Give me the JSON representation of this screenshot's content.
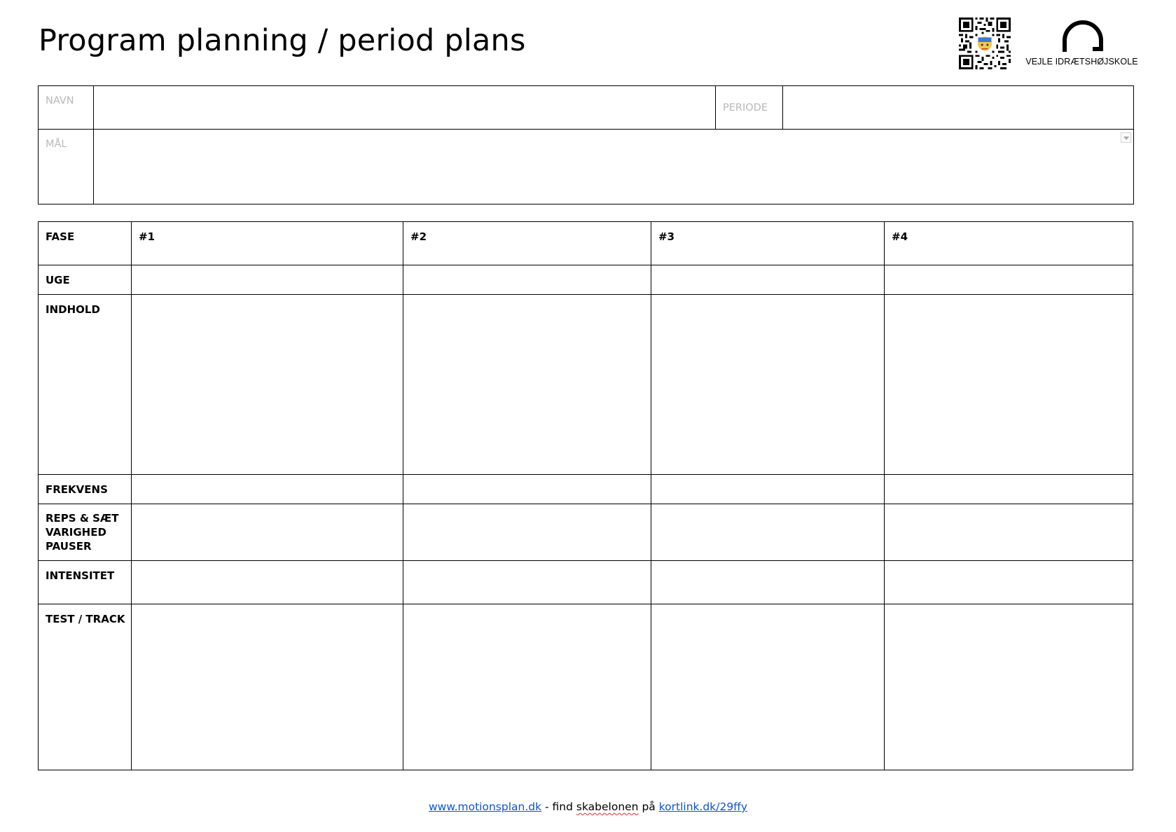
{
  "document": {
    "title": "Program planning / period plans",
    "logo_text": "VEJLE IDRÆTSHØJSKOLE"
  },
  "info": {
    "navn_label": "NAVN",
    "navn_value": "",
    "periode_label": "PERIODE",
    "periode_value": "",
    "maal_label": "MÅL",
    "maal_value": ""
  },
  "plan": {
    "header": {
      "label": "FASE",
      "columns": [
        "#1",
        "#2",
        "#3",
        "#4"
      ]
    },
    "rows": [
      {
        "label": "UGE"
      },
      {
        "label": "INDHOLD"
      },
      {
        "label": "FREKVENS"
      },
      {
        "label": "REPS & SÆT",
        "label2": "VARIGHED",
        "label3": "PAUSER"
      },
      {
        "label": "INTENSITET"
      },
      {
        "label": "TEST / TRACK"
      }
    ]
  },
  "footer": {
    "link1": "www.motionsplan.dk",
    "text1": " - find ",
    "misspelled": "skabelonen",
    "text2": " på ",
    "link2": "kortlink.dk/29ffy"
  },
  "colors": {
    "link": "#1155cc",
    "placeholder_label": "#b8b8b8",
    "spellcheck": "#e03030"
  }
}
